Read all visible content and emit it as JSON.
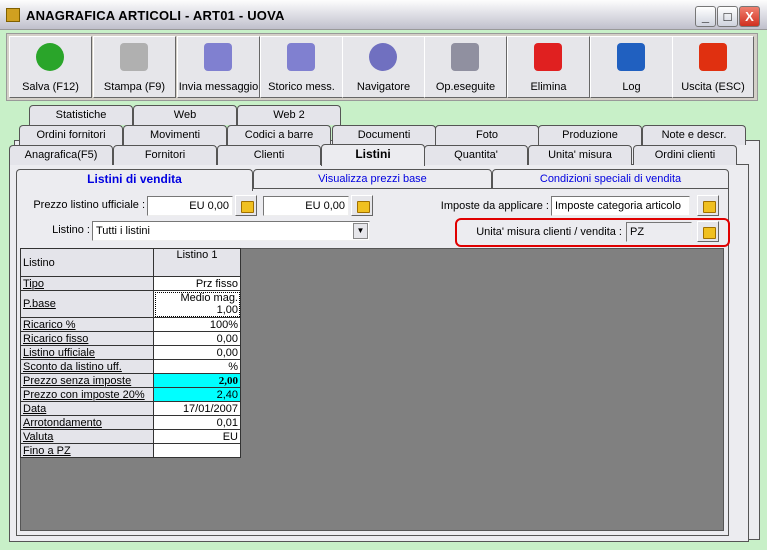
{
  "window": {
    "title": "ANAGRAFICA ARTICOLI - ART01 - UOVA",
    "controls": [
      "_",
      "□",
      "X"
    ]
  },
  "toolbar": [
    {
      "label": "Salva (F12)",
      "icon": "check-icon",
      "color": "#2aa52a"
    },
    {
      "label": "Stampa (F9)",
      "icon": "printer-icon",
      "color": "#b0b0b0"
    },
    {
      "label": "Invia messaggio",
      "icon": "envelope-pen-icon",
      "color": "#8080d0"
    },
    {
      "label": "Storico mess.",
      "icon": "envelope-search-icon",
      "color": "#8080d0"
    },
    {
      "label": "Navigatore",
      "icon": "compass-icon",
      "color": "#7070c0"
    },
    {
      "label": "Op.eseguite",
      "icon": "gears-search-icon",
      "color": "#9090a0"
    },
    {
      "label": "Elimina",
      "icon": "red-x-icon",
      "color": "#e02020"
    },
    {
      "label": "Log",
      "icon": "book-search-icon",
      "color": "#2060c0"
    },
    {
      "label": "Uscita (ESC)",
      "icon": "power-icon",
      "color": "#e03010"
    }
  ],
  "tabs": {
    "row1": [
      "Statistiche",
      "Web",
      "Web 2"
    ],
    "row2": [
      "Ordini fornitori",
      "Movimenti",
      "Codici a barre",
      "Documenti",
      "Foto",
      "Produzione",
      "Note e descr."
    ],
    "row3": [
      "Anagrafica(F5)",
      "Fornitori",
      "Clienti",
      "Listini",
      "Quantita'",
      "Unita' misura",
      "Ordini clienti"
    ],
    "selected": "Listini"
  },
  "subtabs": {
    "items": [
      "Listini di vendita",
      "Visualizza prezzi base",
      "Condizioni speciali di vendita"
    ],
    "selected": "Listini di vendita"
  },
  "form": {
    "prezzo_label": "Prezzo listino ufficiale :",
    "prezzo1": "EU 0,00",
    "prezzo2": "EU 0,00",
    "imposte_label": "Imposte da applicare :",
    "imposte": "Imposte categoria articolo",
    "listino_label": "Listino :",
    "listino": "Tutti i listini",
    "um_label": "Unita' misura clienti / vendita :",
    "um": "PZ",
    "highlight_color": "#e00000"
  },
  "grid": {
    "header": [
      "Listino",
      "Listino 1"
    ],
    "rows": [
      [
        "Tipo",
        "Prz fisso"
      ],
      [
        "P.base",
        "Medio mag.",
        "1,00"
      ],
      [
        "Ricarico %",
        "100%"
      ],
      [
        "Ricarico fisso",
        "0,00"
      ],
      [
        "Listino ufficiale",
        "0,00"
      ],
      [
        "Sconto da listino uff.",
        "%"
      ],
      [
        "Prezzo senza imposte",
        "2,00"
      ],
      [
        "Prezzo con imposte 20%",
        "2,40"
      ],
      [
        "Data",
        "17/01/2007"
      ],
      [
        "Arrotondamento",
        "0,01"
      ],
      [
        "Valuta",
        "EU"
      ],
      [
        "Fino a PZ",
        ""
      ]
    ]
  }
}
